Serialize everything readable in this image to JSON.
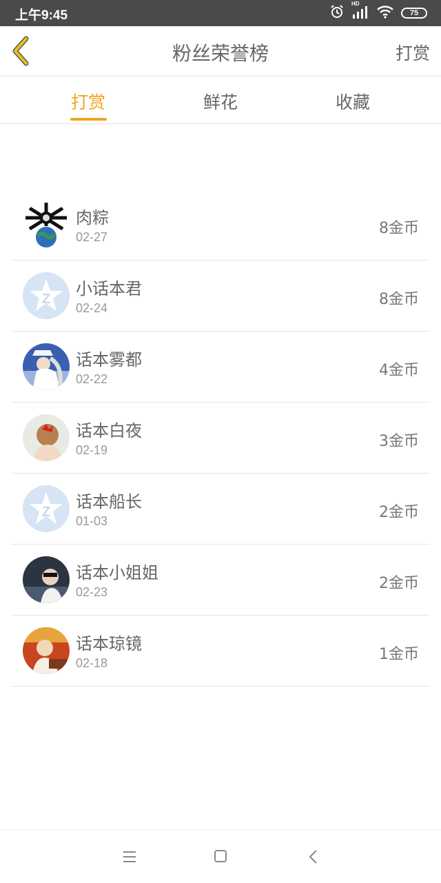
{
  "status_bar": {
    "time": "上午9:45",
    "battery": "75",
    "network": "HD"
  },
  "header": {
    "title": "粉丝荣誉榜",
    "right_action": "打赏"
  },
  "tabs": [
    {
      "label": "打赏",
      "active": true
    },
    {
      "label": "鲜花",
      "active": false
    },
    {
      "label": "收藏",
      "active": false
    }
  ],
  "rows": [
    {
      "name": "肉粽",
      "date": "02-27",
      "amount": "8金币"
    },
    {
      "name": "小话本君",
      "date": "02-24",
      "amount": "8金币"
    },
    {
      "name": "话本雾都",
      "date": "02-22",
      "amount": "4金币"
    },
    {
      "name": "话本白夜",
      "date": "02-19",
      "amount": "3金币"
    },
    {
      "name": "话本船长",
      "date": "01-03",
      "amount": "2金币"
    },
    {
      "name": "话本小姐姐",
      "date": "02-23",
      "amount": "2金币"
    },
    {
      "name": "话本琼镜",
      "date": "02-18",
      "amount": "1金币"
    }
  ],
  "colors": {
    "accent": "#f2a31c",
    "back_arrow": "#e6c21c",
    "status_bg": "#4a4a4a"
  }
}
